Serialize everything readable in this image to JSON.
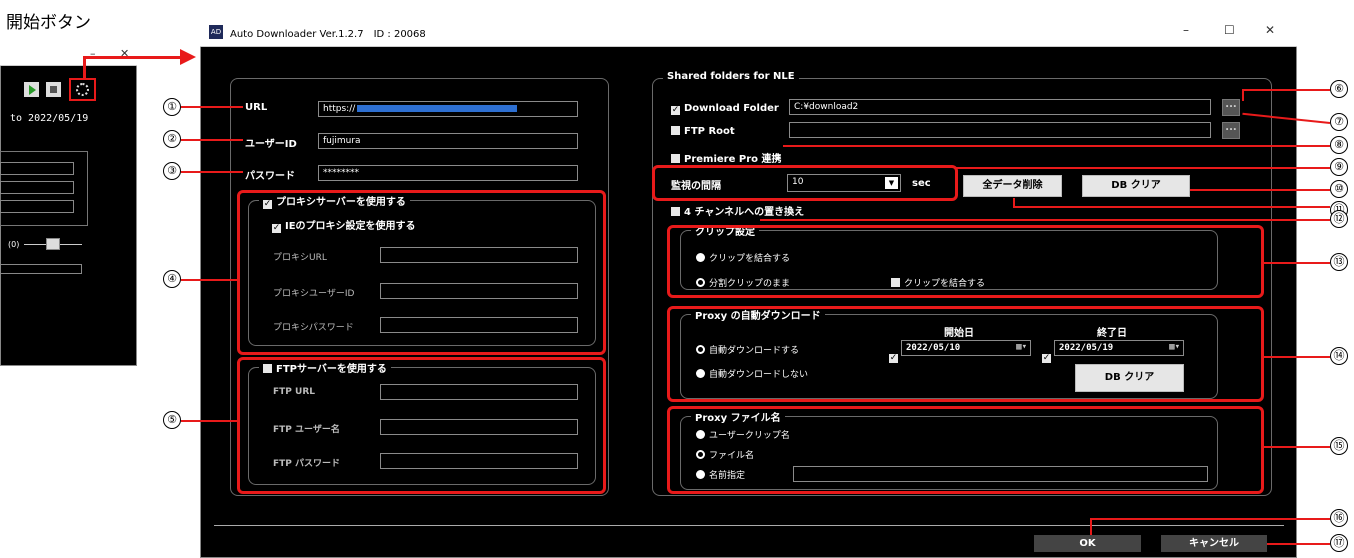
{
  "annotation": {
    "start_button": "開始ボタン"
  },
  "mini": {
    "date_text": "to 2022/05/19",
    "slider_label": "(0)"
  },
  "window": {
    "title": "Auto Downloader Ver.1.2.7　ID : 20068",
    "minimize": "–",
    "maximize": "☐",
    "close": "✕"
  },
  "left": {
    "url_label": "URL",
    "url_value": "https://",
    "user_label": "ユーザーID",
    "user_value": "fujimura",
    "pass_label": "パスワード",
    "pass_value": "********",
    "proxy": {
      "title": "プロキシサーバーを使用する",
      "ie": "IEのプロキシ設定を使用する",
      "url": "プロキシURL",
      "user": "プロキシユーザーID",
      "pass": "プロキシパスワード"
    },
    "ftp": {
      "title": "FTPサーバーを使用する",
      "url": "FTP URL",
      "user": "FTP ユーザー名",
      "pass": "FTP パスワード"
    }
  },
  "right": {
    "shared": {
      "title": "Shared folders for NLE",
      "download": "Download Folder",
      "download_path": "C:¥download2",
      "ftp_root": "FTP Root",
      "premiere": "Premiere Pro 連携",
      "browse": "..."
    },
    "monitor": {
      "label": "監視の間隔",
      "value": "10",
      "unit": "sec"
    },
    "btn_delete_all": "全データ削除",
    "btn_db_clear": "DB クリア",
    "channel": "4 チャンネルへの置き換え",
    "clip": {
      "title": "クリップ設定",
      "opt1": "クリップを結合する",
      "opt2": "分割クリップのまま",
      "merge": "クリップを結合する"
    },
    "proxy_dl": {
      "title": "Proxy の自動ダウンロード",
      "start_label": "開始日",
      "end_label": "終了日",
      "start": "2022/05/10",
      "end": "2022/05/19",
      "opt1": "自動ダウンロードする",
      "opt2": "自動ダウンロードしない",
      "db_clear": "DB クリア"
    },
    "proxy_name": {
      "title": "Proxy ファイル名",
      "opt1": "ユーザークリップ名",
      "opt2": "ファイル名",
      "opt3": "名前指定"
    }
  },
  "footer": {
    "ok": "OK",
    "cancel": "キャンセル"
  },
  "markers": [
    "①",
    "②",
    "③",
    "④",
    "⑤",
    "⑥",
    "⑦",
    "⑧",
    "⑨",
    "⑩",
    "⑪",
    "⑫",
    "⑬",
    "⑭",
    "⑮",
    "⑯",
    "⑰"
  ]
}
